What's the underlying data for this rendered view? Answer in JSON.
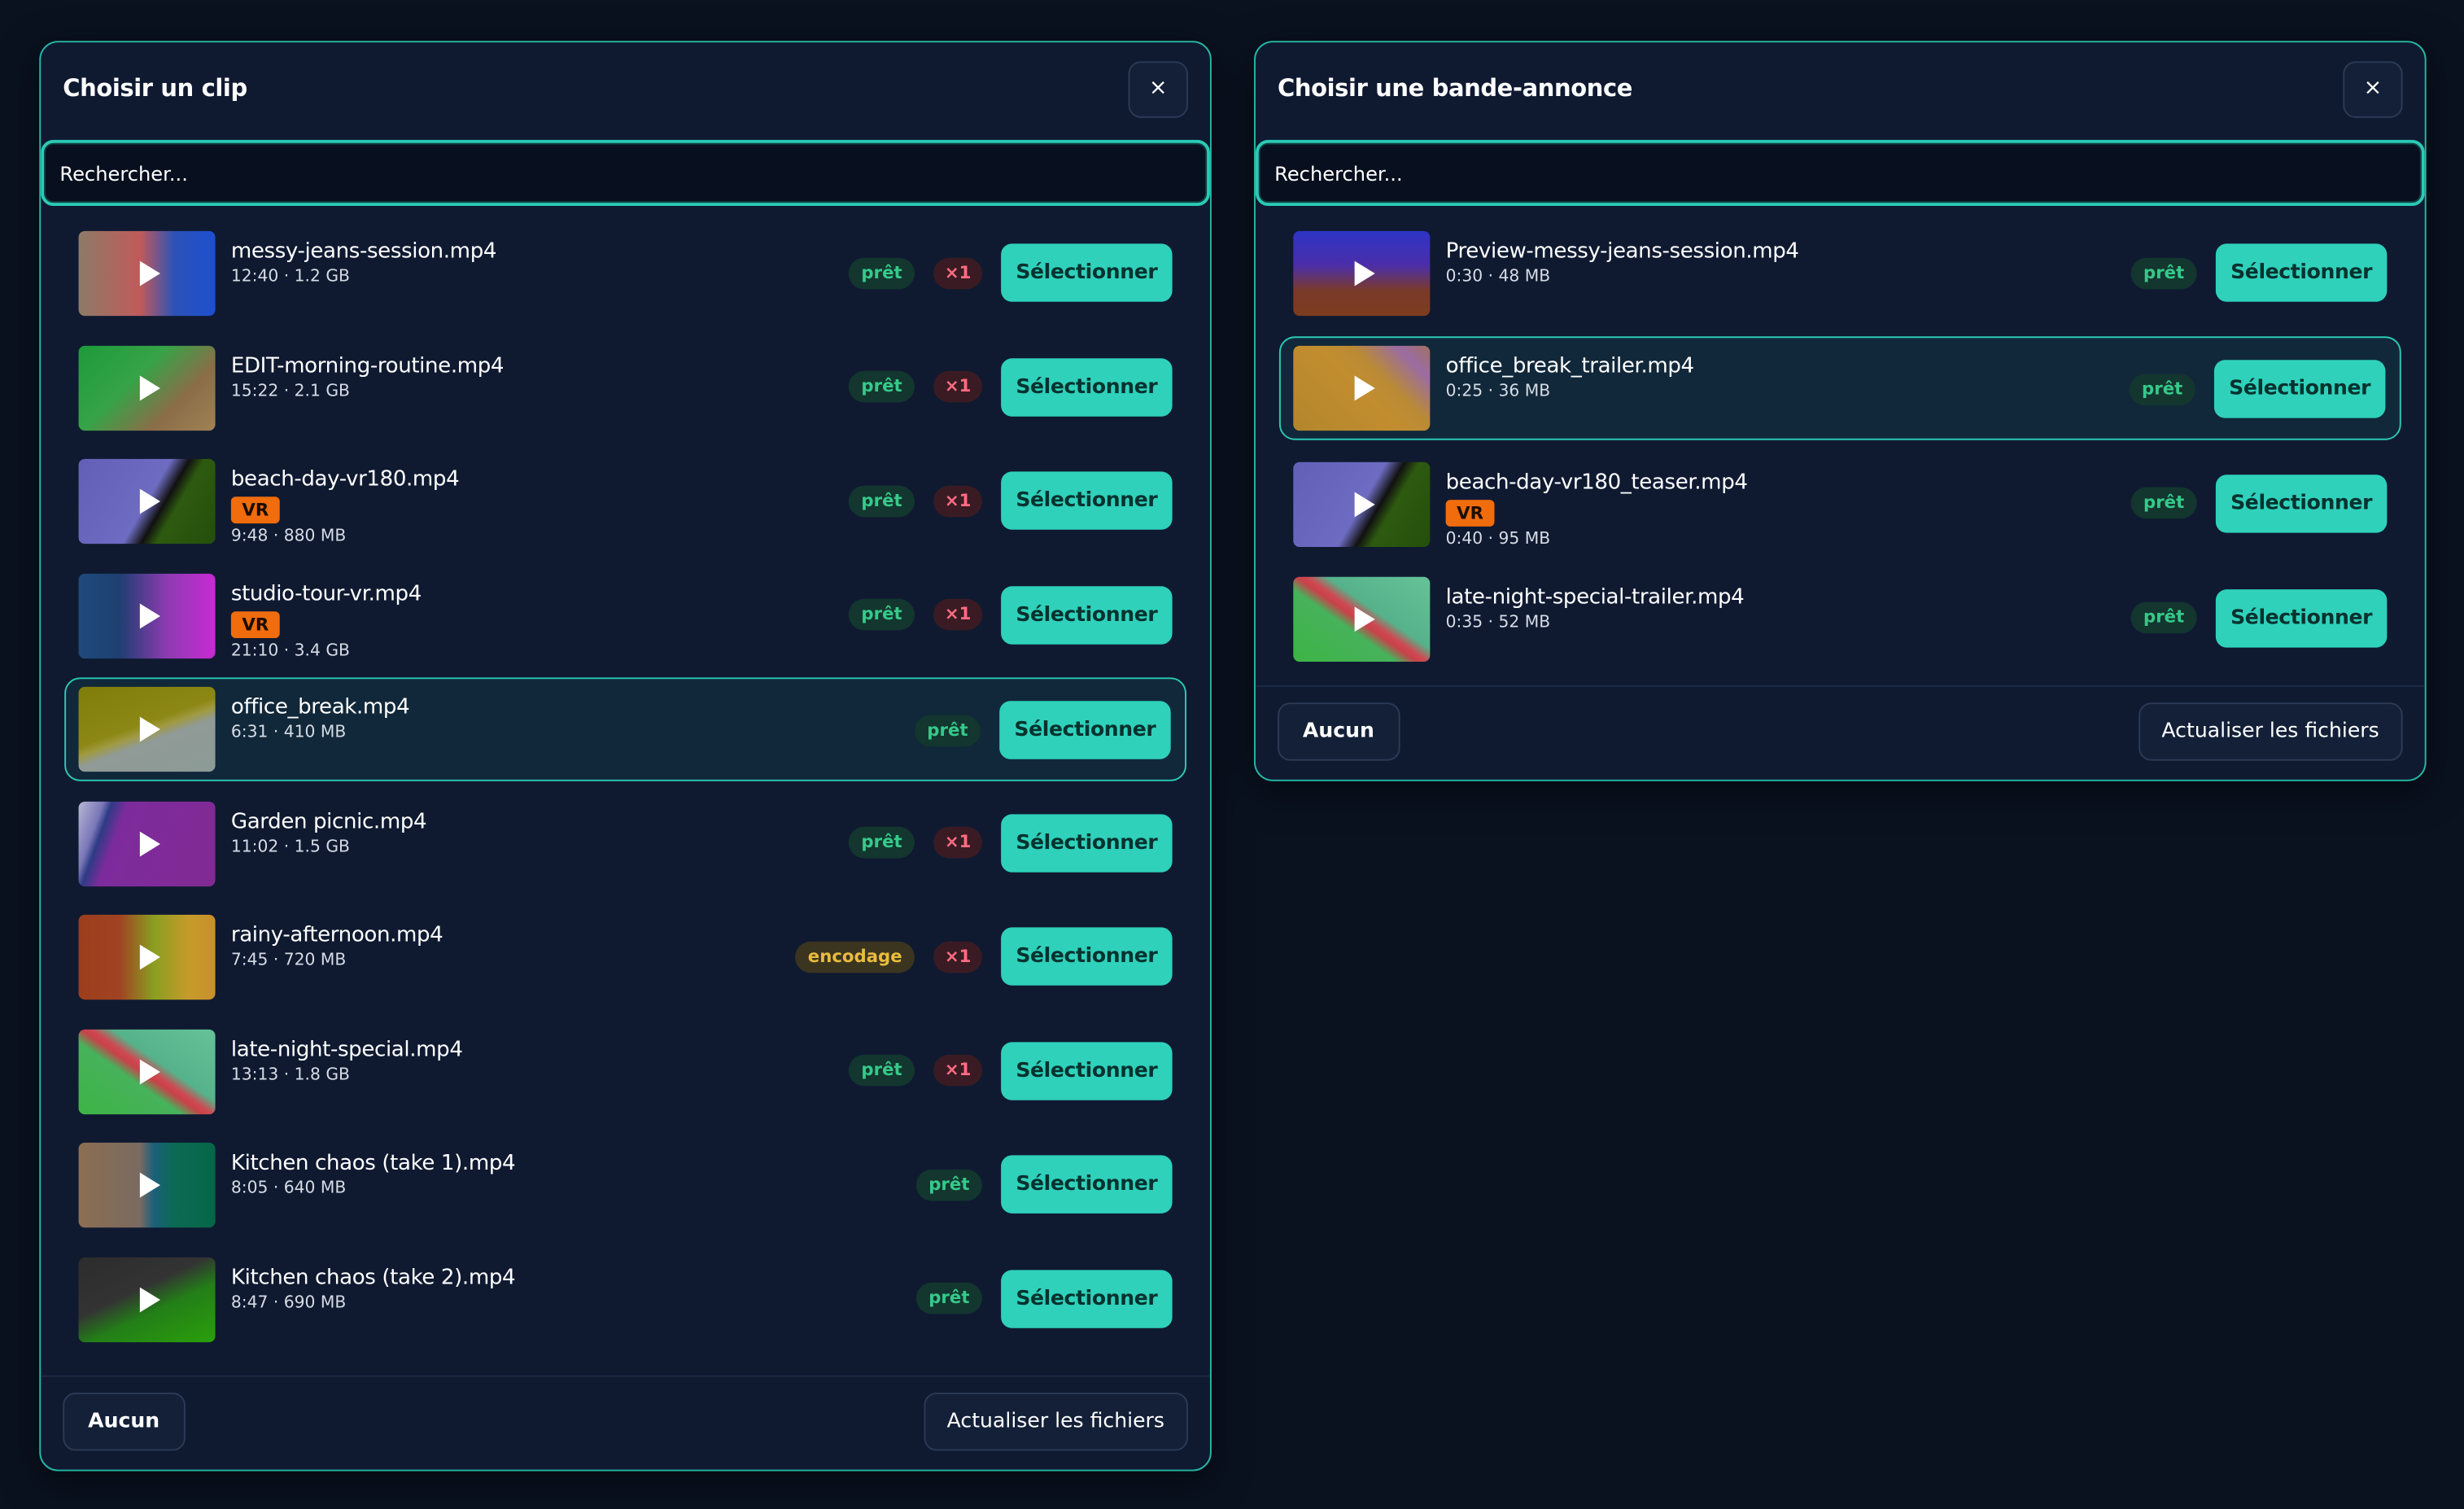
{
  "clip_dialog": {
    "title": "Choisir un clip",
    "close_label": "×",
    "search_placeholder": "Rechercher...",
    "items": [
      {
        "name": "messy-jeans-session.mp4",
        "meta": "12:40 · 1.2 GB",
        "status": "prêt",
        "count": "×1",
        "vr": null,
        "selected": false,
        "thumb": "linear-gradient(90deg,#8c7b67 0%,#c15a5a 45%,#2c52b7 70%,#1d4fd0 100%)"
      },
      {
        "name": "EDIT-morning-routine.mp4",
        "meta": "15:22 · 2.1 GB",
        "status": "prêt",
        "count": "×1",
        "vr": null,
        "selected": false,
        "thumb": "linear-gradient(135deg,#1d9a3b 0%,#36a347 40%,#8a6d48 70%,#a08254 100%)"
      },
      {
        "name": "beach-day-vr180.mp4",
        "meta": "9:48 · 880 MB",
        "status": "prêt",
        "count": "×1",
        "vr": "VR",
        "selected": false,
        "thumb": "linear-gradient(120deg,#6260b6 0%,#6e6cc2 50%,#111111 60%,#2e5a10 68%,#244e0b 100%)"
      },
      {
        "name": "studio-tour-vr.mp4",
        "meta": "21:10 · 3.4 GB",
        "status": "prêt",
        "count": "×1",
        "vr": "VR",
        "selected": false,
        "thumb": "linear-gradient(90deg,#1f4a7c 0%,#1e3f70 30%,#8e3bb2 65%,#c82ad3 100%)"
      },
      {
        "name": "office_break.mp4",
        "meta": "6:31 · 410 MB",
        "status": "prêt",
        "count": null,
        "vr": null,
        "selected": true,
        "thumb": "linear-gradient(160deg,#7f7d0a 0%,#8d8815 45%,#a09a42 52%,#909a96 60%,#8c9b97 100%)"
      },
      {
        "name": "Garden picnic.mp4",
        "meta": "11:02 · 1.5 GB",
        "status": "prêt",
        "count": "×1",
        "vr": null,
        "selected": false,
        "thumb": "linear-gradient(110deg,#b8b7d3 0%,#7a77b8 15%,#2e3b85 20%,#7d2b9c 30%,#812a94 100%)"
      },
      {
        "name": "rainy-afternoon.mp4",
        "meta": "7:45 · 720 MB",
        "status": "encodage",
        "count": "×1",
        "vr": null,
        "selected": false,
        "thumb": "linear-gradient(90deg,#9c3e1c 0%,#a14322 30%,#8a9e21 55%,#c59b2a 80%,#c88f2b 100%)"
      },
      {
        "name": "late-night-special.mp4",
        "meta": "13:13 · 1.8 GB",
        "status": "prêt",
        "count": "×1",
        "vr": null,
        "selected": false,
        "thumb": "linear-gradient(35deg,#3db444 0%,#46b25b 40%,#c8424a 48%,#cf4952 52%,#56b28a 60%,#66c298 100%)"
      },
      {
        "name": "Kitchen chaos (take 1).mp4",
        "meta": "8:05 · 640 MB",
        "status": "prêt",
        "count": null,
        "vr": null,
        "selected": false,
        "thumb": "linear-gradient(90deg,#8c6e52 0%,#7a6a60 45%,#1b5f7a 55%,#0b6a52 70%,#066648 100%)"
      },
      {
        "name": "Kitchen chaos (take 2).mp4",
        "meta": "8:47 · 690 MB",
        "status": "prêt",
        "count": null,
        "vr": null,
        "selected": false,
        "thumb": "linear-gradient(155deg,#2c2c2c 0%,#333333 40%,#237e18 60%,#2aa00a 100%)"
      }
    ],
    "select_label": "Sélectionner",
    "footer": {
      "none_label": "Aucun",
      "refresh_label": "Actualiser les fichiers"
    }
  },
  "trailer_dialog": {
    "title": "Choisir une bande-annonce",
    "close_label": "×",
    "search_placeholder": "Rechercher...",
    "items": [
      {
        "name": "Preview-messy-jeans-session.mp4",
        "meta": "0:30 · 48 MB",
        "status": "prêt",
        "count": null,
        "vr": null,
        "selected": false,
        "thumb": "linear-gradient(180deg,#2d34c5 0%,#4b2eaa 40%,#7a3a2a 70%,#7c3c1e 100%)"
      },
      {
        "name": "office_break_trailer.mp4",
        "meta": "0:25 · 36 MB",
        "status": "prêt",
        "count": null,
        "vr": null,
        "selected": true,
        "thumb": "linear-gradient(45deg,#b3862c 0%,#c28d2f 50%,#b98a36 65%,#9b6ca4 85%,#a07060 100%)"
      },
      {
        "name": "beach-day-vr180_teaser.mp4",
        "meta": "0:40 · 95 MB",
        "status": "prêt",
        "count": null,
        "vr": "VR",
        "selected": false,
        "thumb": "linear-gradient(120deg,#6260b6 0%,#6e6cc2 50%,#111111 60%,#2e5a10 68%,#244e0b 100%)"
      },
      {
        "name": "late-night-special-trailer.mp4",
        "meta": "0:35 · 52 MB",
        "status": "prêt",
        "count": null,
        "vr": null,
        "selected": false,
        "thumb": "linear-gradient(35deg,#3db444 0%,#46b25b 40%,#c8424a 48%,#cf4952 52%,#56b28a 60%,#66c298 100%)"
      }
    ],
    "select_label": "Sélectionner",
    "footer": {
      "none_label": "Aucun",
      "refresh_label": "Actualiser les fichiers"
    }
  },
  "colors": {
    "background": "#0a1220",
    "panel": "#0f1a31",
    "accent": "#2fd1bb",
    "ready": "#36c98a",
    "encoding": "#e9bc3c",
    "count": "#ff6d82",
    "vr": "#f06c0c"
  }
}
